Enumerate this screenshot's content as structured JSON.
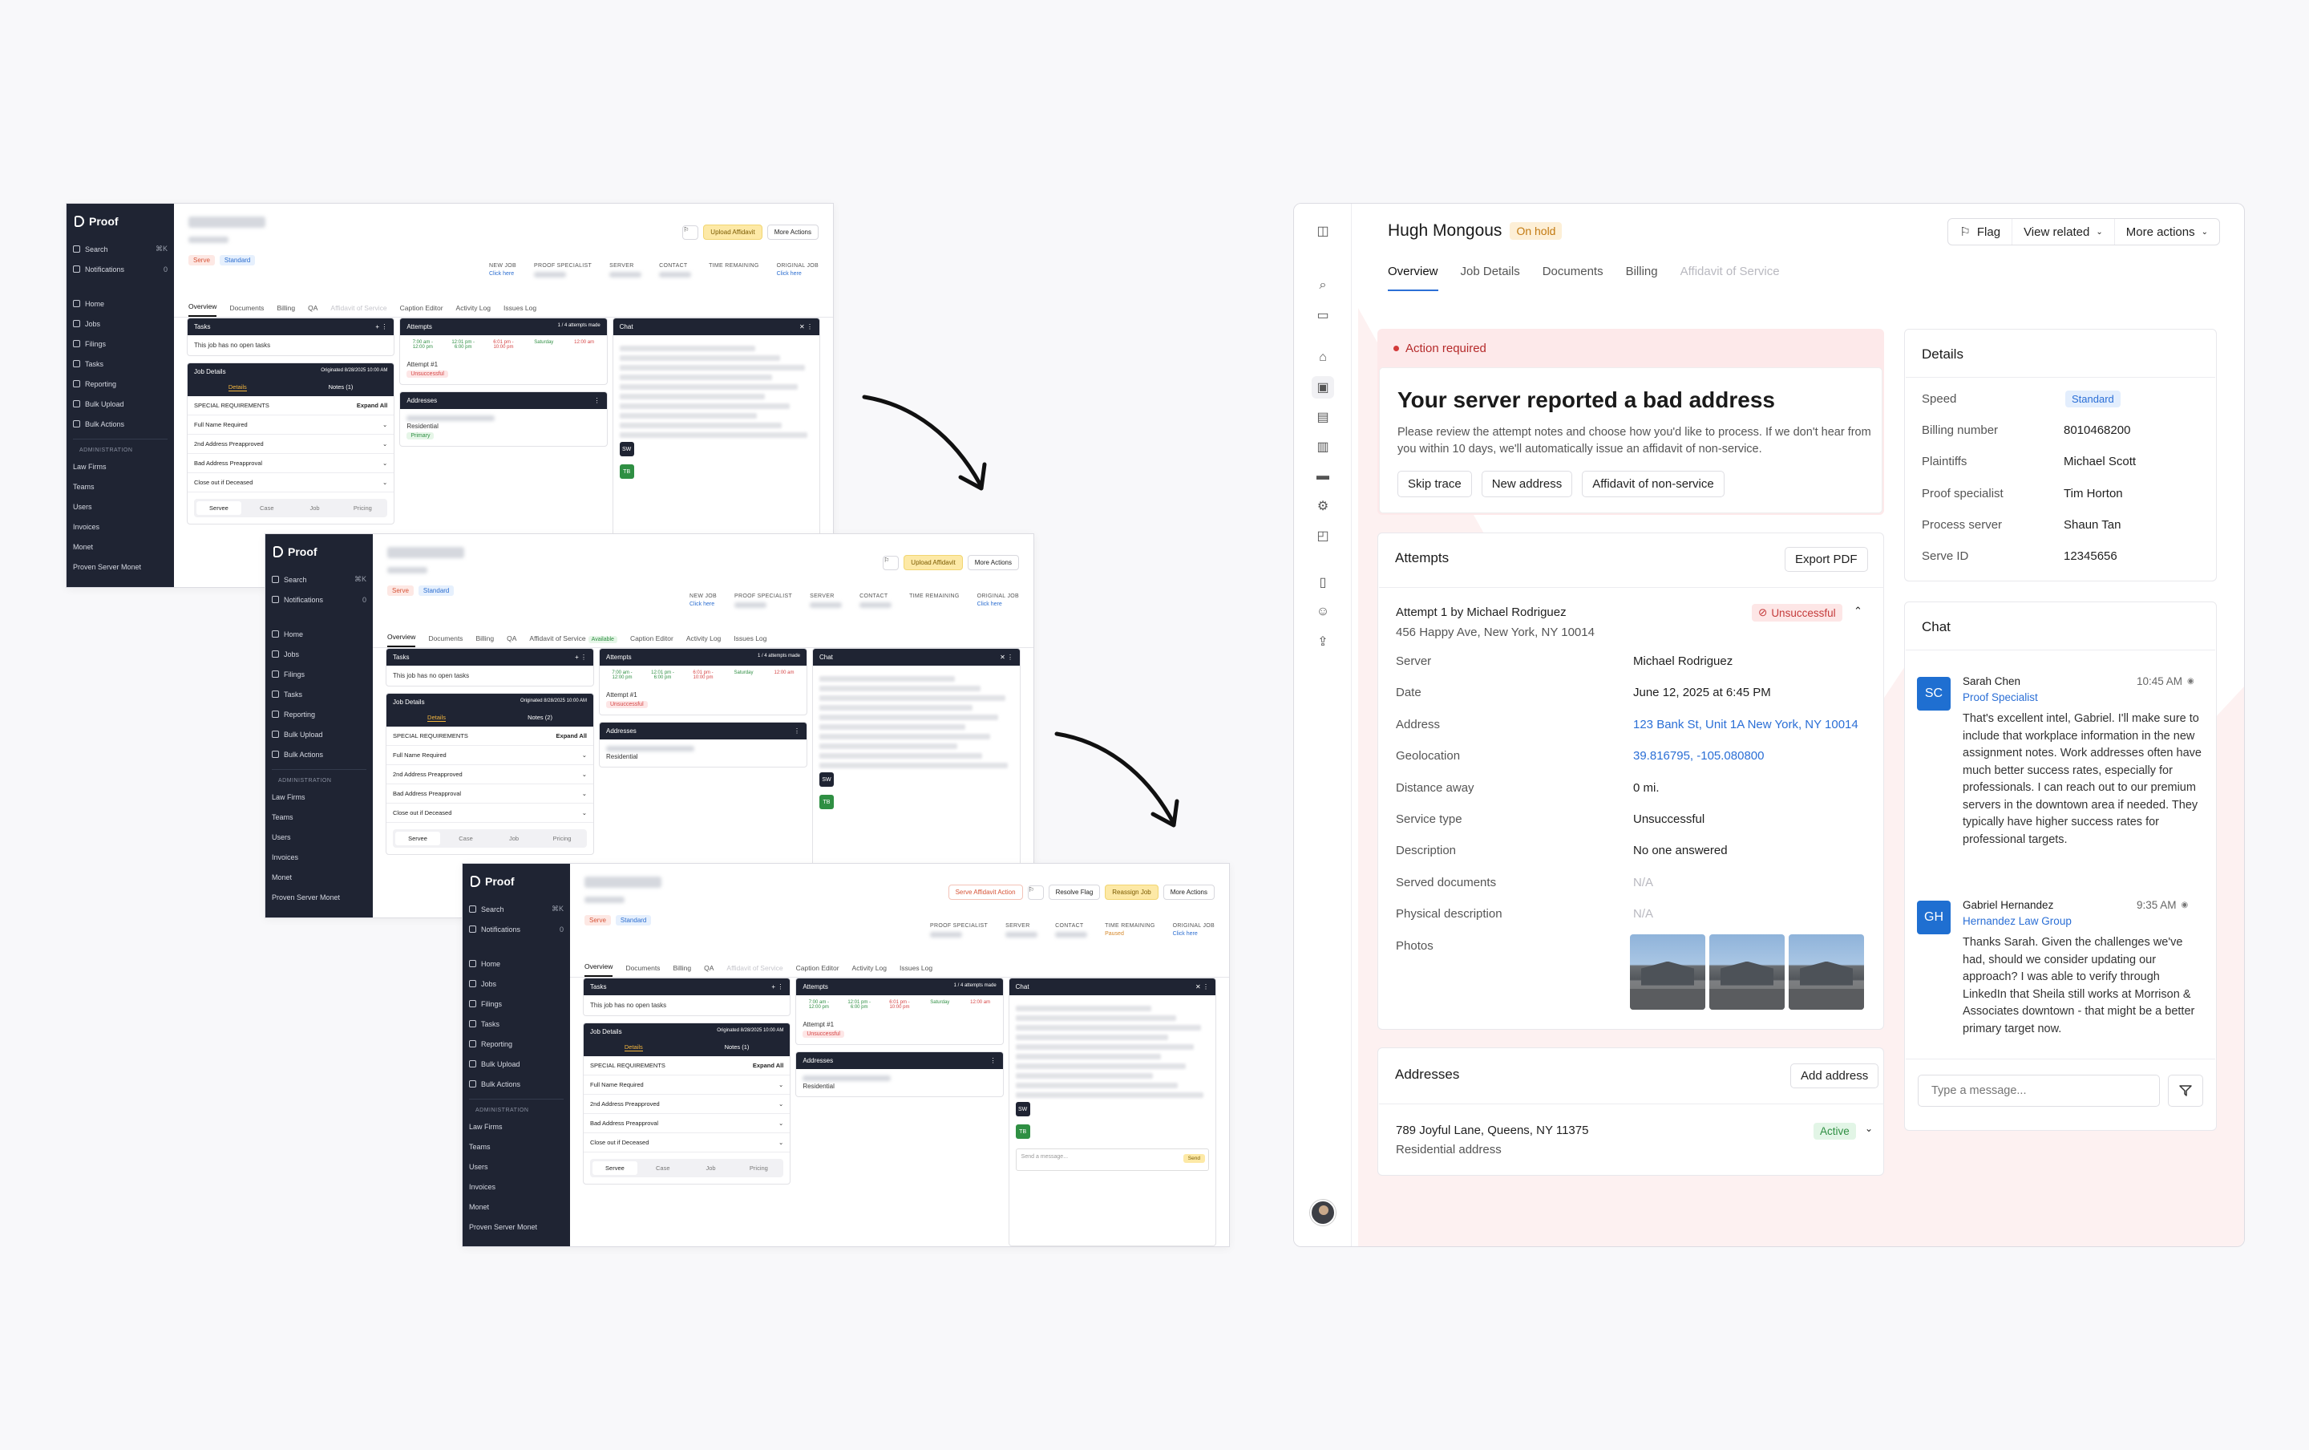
{
  "old": {
    "logo": "Proof",
    "nav": [
      {
        "label": "Search",
        "kbd": "⌘K"
      },
      {
        "label": "Notifications",
        "kbd": "0"
      }
    ],
    "nav2": [
      "Home",
      "Jobs",
      "Filings",
      "Tasks",
      "Reporting",
      "Bulk Upload",
      "Bulk Actions"
    ],
    "admin_label": "ADMINISTRATION",
    "admin": [
      "Law Firms",
      "Teams",
      "Users",
      "Invoices",
      "Monet",
      "Proven Server Monet"
    ],
    "tag_serve": "Serve",
    "tag_std": "Standard",
    "btn_upload": "Upload Affidavit",
    "btn_more": "More Actions",
    "btn_resolve": "Resolve Flag",
    "btn_reassign": "Reassign Job",
    "btn_serve_action": "Serve Affidavit Action",
    "meta": {
      "new_job": "NEW JOB",
      "click_here": "Click here",
      "proof_specialist": "PROOF SPECIALIST",
      "server": "SERVER",
      "contact": "CONTACT",
      "time_remaining": "TIME REMAINING",
      "original_job": "ORIGINAL JOB",
      "paused": "Paused"
    },
    "tabs": [
      "Overview",
      "Documents",
      "Billing",
      "QA",
      "Affidavit of Service",
      "Caption Editor",
      "Activity Log",
      "Issues Log"
    ],
    "available": "Available",
    "tasks": "Tasks",
    "no_tasks": "This job has no open tasks",
    "job_details": "Job Details",
    "originated": "Originated 8/28/2025 10:00 AM",
    "details_tab": "Details",
    "notes_tab": "Notes (1)",
    "notes_tab2": "Notes (2)",
    "special_req": "SPECIAL REQUIREMENTS",
    "expand_all": "Expand All",
    "reqs": [
      "Full Name Required",
      "2nd Address Preapproved",
      "Bad Address Preapproval",
      "Close out if Deceased"
    ],
    "serve_tabs": [
      "Servee",
      "Case",
      "Job",
      "Pricing"
    ],
    "attempts": "Attempts",
    "attempts_made": "1 / 4 attempts made",
    "slot1": "7:00 am - 12:00 pm",
    "slot2": "12:01 pm - 6:00 pm",
    "slot3": "6:01 pm - 10:00 pm",
    "slot4": "Saturday",
    "slot5": "12:00 am",
    "attempt1": "Attempt #1",
    "unsuccessful": "Unsuccessful",
    "addresses": "Addresses",
    "residential": "Residential",
    "primary": "Primary",
    "chat": "Chat",
    "send_msg": "Send a message...",
    "send": "Send"
  },
  "app": {
    "title": "Hugh Mongous",
    "status": "On hold",
    "actions": {
      "flag": "Flag",
      "view_related": "View related",
      "more": "More actions"
    },
    "tabs": [
      "Overview",
      "Job Details",
      "Documents",
      "Billing",
      "Affidavit of Service"
    ],
    "action_required": {
      "label": "Action required",
      "heading": "Your server reported a bad address",
      "body": "Please review the attempt notes and choose how you'd like to process. If we don't hear from you within 10 days, we'll automatically issue an affidavit of non-service.",
      "buttons": [
        "Skip trace",
        "New address",
        "Affidavit of non-service"
      ]
    },
    "attempts": {
      "title": "Attempts",
      "export": "Export PDF",
      "attempt_title": "Attempt 1 by Michael Rodriguez",
      "attempt_addr": "456 Happy Ave, New York, NY 10014",
      "status": "Unsuccessful",
      "fields": [
        {
          "k": "Server",
          "v": "Michael Rodriguez",
          "t": "v"
        },
        {
          "k": "Date",
          "v": "June 12, 2025 at 6:45 PM",
          "t": "v"
        },
        {
          "k": "Address",
          "v": "123 Bank St, Unit 1A New York, NY 10014",
          "t": "link"
        },
        {
          "k": "Geolocation",
          "v": "39.816795, -105.080800",
          "t": "link"
        },
        {
          "k": "Distance away",
          "v": "0 mi.",
          "t": "v"
        },
        {
          "k": "Service type",
          "v": "Unsuccessful",
          "t": "v"
        },
        {
          "k": "Description",
          "v": "No one answered",
          "t": "v"
        },
        {
          "k": "Served documents",
          "v": "N/A",
          "t": "na"
        },
        {
          "k": "Physical description",
          "v": "N/A",
          "t": "na"
        },
        {
          "k": "Photos",
          "v": "",
          "t": "photos"
        }
      ]
    },
    "addresses": {
      "title": "Addresses",
      "add": "Add address",
      "line1": "789 Joyful Lane, Queens, NY 11375",
      "line2": "Residential address",
      "status": "Active"
    },
    "details": {
      "title": "Details",
      "rows": [
        {
          "k": "Speed",
          "v": "Standard"
        },
        {
          "k": "Billing number",
          "v": "8010468200"
        },
        {
          "k": "Plaintiffs",
          "v": "Michael Scott"
        },
        {
          "k": "Proof specialist",
          "v": "Tim Horton"
        },
        {
          "k": "Process server",
          "v": "Shaun Tan"
        },
        {
          "k": "Serve ID",
          "v": "12345656"
        }
      ]
    },
    "chat": {
      "title": "Chat",
      "messages": [
        {
          "initials": "SC",
          "name": "Sarah Chen",
          "role": "Proof Specialist",
          "time": "10:45 AM",
          "body": "That's excellent intel, Gabriel. I'll make sure to include that workplace information in the new assignment notes. Work addresses often have much better success rates, especially for professionals. I can reach out to our premium servers in the downtown area if needed. They typically have higher success rates for professional targets."
        },
        {
          "initials": "GH",
          "name": "Gabriel Hernandez",
          "role": "Hernandez Law Group",
          "time": "9:35 AM",
          "body": "Thanks Sarah. Given the challenges we've had, should we consider updating our approach? I was able to verify through LinkedIn that Sheila still works at Morrison & Associates downtown - that might be a better primary target now."
        }
      ],
      "placeholder": "Type a message..."
    }
  }
}
